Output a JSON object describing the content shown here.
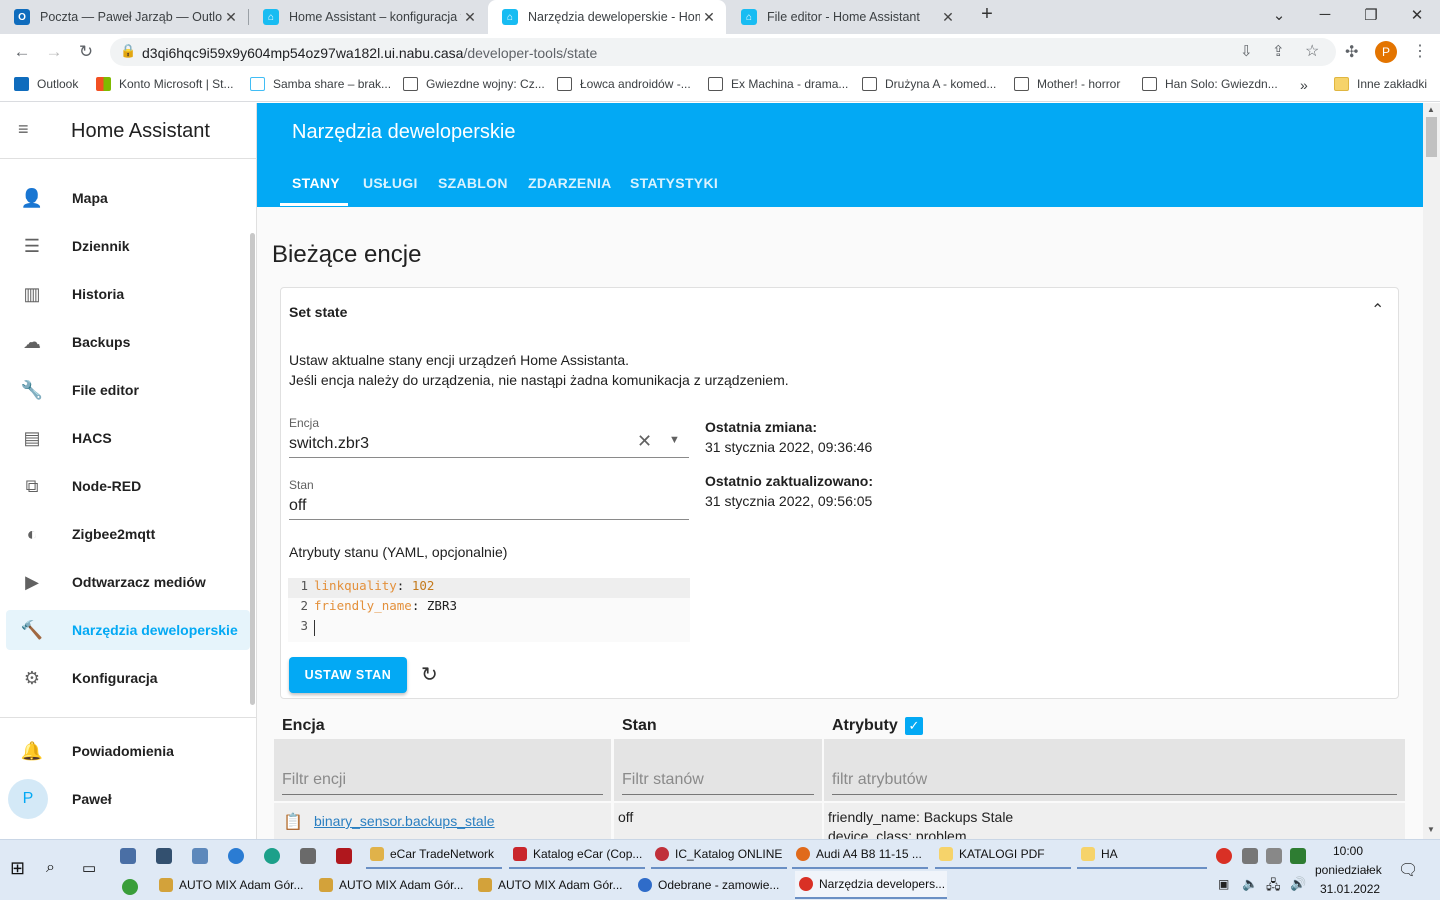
{
  "browser": {
    "tabs": [
      {
        "title": "Poczta — Paweł Jarząb — Outlook",
        "color": "#0f6cbd",
        "letter": "O"
      },
      {
        "title": "Home Assistant – konfiguracja te",
        "color": "#18bcf2",
        "letter": "⌂"
      },
      {
        "title": "Narzędzia deweloperskie - Home",
        "color": "#18bcf2",
        "letter": "⌂"
      },
      {
        "title": "File editor - Home Assistant",
        "color": "#18bcf2",
        "letter": "⌂"
      }
    ],
    "new_tab": "+",
    "url_host": "d3qi6hqc9i59x9y604mp54oz97wa182l.ui.nabu.casa",
    "url_path": "/developer-tools/state",
    "profile_letter": "P",
    "bookmarks": [
      "Outlook",
      "Konto Microsoft | St...",
      "Samba share – brak...",
      "Gwiezdne wojny: Cz...",
      "Łowca androidów -...",
      "Ex Machina - drama...",
      "Drużyna A - komed...",
      "Mother! - horror",
      "Han Solo: Gwiezdn..."
    ],
    "bookmarks_more": "»",
    "other_bookmarks": "Inne zakładki"
  },
  "sidebar": {
    "title": "Home Assistant",
    "items": [
      {
        "label": "Mapa",
        "icon": "👤"
      },
      {
        "label": "Dziennik",
        "icon": "☰"
      },
      {
        "label": "Historia",
        "icon": "▥"
      },
      {
        "label": "Backups",
        "icon": "☁"
      },
      {
        "label": "File editor",
        "icon": "🔧"
      },
      {
        "label": "HACS",
        "icon": "▤"
      },
      {
        "label": "Node-RED",
        "icon": "⧉"
      },
      {
        "label": "Zigbee2mqtt",
        "icon": "◐"
      },
      {
        "label": "Odtwarzacz mediów",
        "icon": "▶"
      },
      {
        "label": "Narzędzia deweloperskie",
        "icon": "🔨"
      },
      {
        "label": "Konfiguracja",
        "icon": "⚙"
      }
    ],
    "notifications": "Powiadomienia",
    "user": "Paweł",
    "user_initial": "P"
  },
  "header": {
    "title": "Narzędzia deweloperskie",
    "tabs": [
      "STANY",
      "USŁUGI",
      "SZABLON",
      "ZDARZENIA",
      "STATYSTYKI"
    ]
  },
  "page": {
    "heading": "Bieżące encje",
    "card_title": "Set state",
    "desc1": "Ustaw aktualne stany encji urządzeń Home Assistanta.",
    "desc2": "Jeśli encja należy do urządzenia, nie nastąpi żadna komunikacja z urządzeniem.",
    "entity_label": "Encja",
    "entity_value": "switch.zbr3",
    "state_label": "Stan",
    "state_value": "off",
    "attr_label": "Atrybuty stanu (YAML, opcjonalnie)",
    "code": [
      {
        "n": "1",
        "key": "linkquality",
        "val": "102"
      },
      {
        "n": "2",
        "key": "friendly_name",
        "val": "ZBR3"
      },
      {
        "n": "3",
        "key": "",
        "val": ""
      }
    ],
    "last_changed_label": "Ostatnia zmiana:",
    "last_changed": "31 stycznia 2022, 09:36:46",
    "last_updated_label": "Ostatnio zaktualizowano:",
    "last_updated": "31 stycznia 2022, 09:56:05",
    "set_button": "USTAW STAN"
  },
  "table": {
    "col_entity": "Encja",
    "col_state": "Stan",
    "col_attrs": "Atrybuty",
    "filter_entity": "Filtr encji",
    "filter_state": "Filtr stanów",
    "filter_attrs": "filtr atrybutów",
    "row_entity": "binary_sensor.backups_stale",
    "row_state": "off",
    "row_attr1": "friendly_name: Backups Stale",
    "row_attr2": "device_class: problem"
  },
  "taskbar": {
    "row1": [
      "eCar TradeNetwork",
      "Katalog eCar (Cop...",
      "IC_Katalog ONLINE",
      "Audi A4 B8 11-15 ...",
      "KATALOGI PDF",
      "HA"
    ],
    "row2": [
      "AUTO MIX Adam Gór...",
      "AUTO MIX Adam Gór...",
      "AUTO MIX Adam Gór...",
      "Odebrane - zamowie...",
      "Narzędzia developers..."
    ],
    "time": "10:00",
    "day": "poniedziałek",
    "date": "31.01.2022"
  }
}
